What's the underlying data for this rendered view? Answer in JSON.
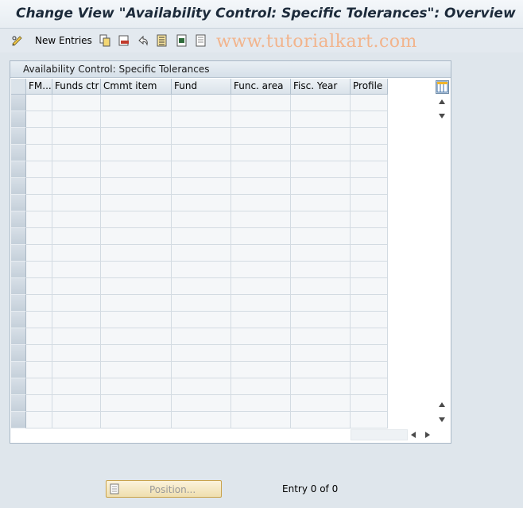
{
  "window": {
    "title": "Change View \"Availability Control: Specific Tolerances\": Overview"
  },
  "toolbar": {
    "new_entries_label": "New Entries",
    "icons": [
      "glasses-pencil-icon",
      "copy-icon",
      "delete-icon",
      "undo-icon",
      "select-all-icon",
      "select-block-icon",
      "deselect-all-icon"
    ]
  },
  "watermark": "www.tutorialkart.com",
  "table": {
    "title": "Availability Control: Specific Tolerances",
    "columns": [
      "FM...",
      "Funds ctr",
      "Cmmt item",
      "Fund",
      "Func. area",
      "Fisc. Year",
      "Profile"
    ],
    "row_count": 20
  },
  "footer": {
    "position_label": "Position...",
    "entry_text": "Entry 0 of 0"
  }
}
